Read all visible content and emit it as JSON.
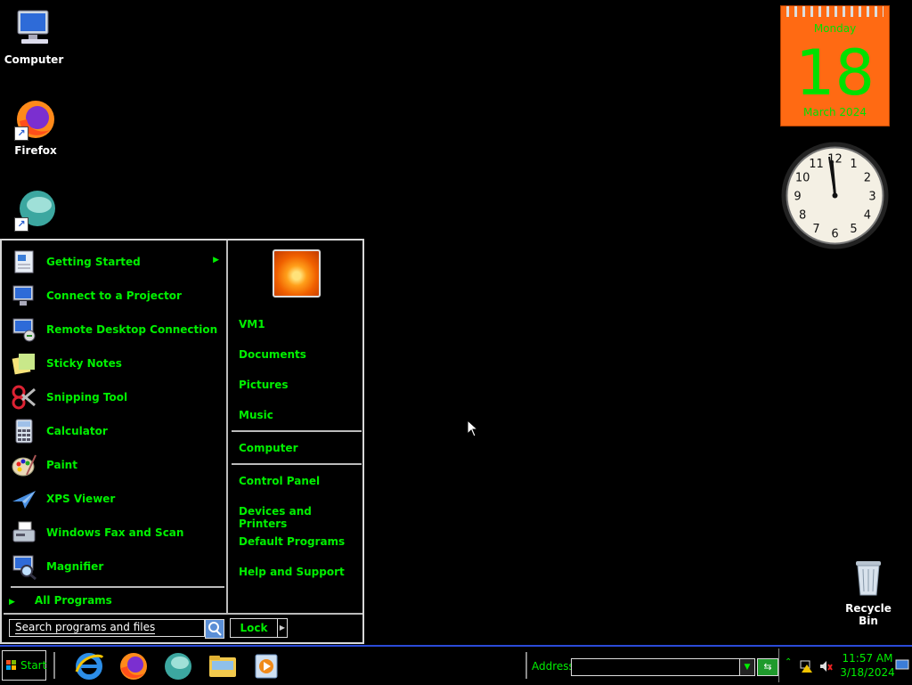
{
  "desktop": {
    "icons": [
      {
        "label": "Computer"
      },
      {
        "label": "Firefox"
      },
      {
        "label": "Recycle Bin"
      }
    ]
  },
  "calendar": {
    "weekday": "Monday",
    "day": "18",
    "month_year": "March 2024"
  },
  "clock": {
    "hour_numbers": [
      "12",
      "1",
      "2",
      "3",
      "4",
      "5",
      "6",
      "7",
      "8",
      "9",
      "10",
      "11"
    ]
  },
  "start_menu": {
    "programs": [
      {
        "label": "Getting Started",
        "has_submenu": true
      },
      {
        "label": "Connect to a Projector"
      },
      {
        "label": "Remote Desktop Connection"
      },
      {
        "label": "Sticky Notes"
      },
      {
        "label": "Snipping Tool"
      },
      {
        "label": "Calculator"
      },
      {
        "label": "Paint"
      },
      {
        "label": "XPS Viewer"
      },
      {
        "label": "Windows Fax and Scan"
      },
      {
        "label": "Magnifier"
      }
    ],
    "all_programs": "All Programs",
    "places_group1": [
      "VM1",
      "Documents",
      "Pictures",
      "Music"
    ],
    "places_group2": [
      "Computer"
    ],
    "places_group3": [
      "Control Panel",
      "Devices and Printers",
      "Default Programs",
      "Help and Support"
    ],
    "search_placeholder": "Search programs and files",
    "lock_label": "Lock"
  },
  "taskbar": {
    "start_label": "Start",
    "address_label": "Address",
    "time": "11:57 AM",
    "date": "3/18/2024"
  },
  "colors": {
    "accent_text": "#00f000",
    "calendar_bg": "#ff6a13",
    "taskbar_border": "#2a4ad8"
  }
}
